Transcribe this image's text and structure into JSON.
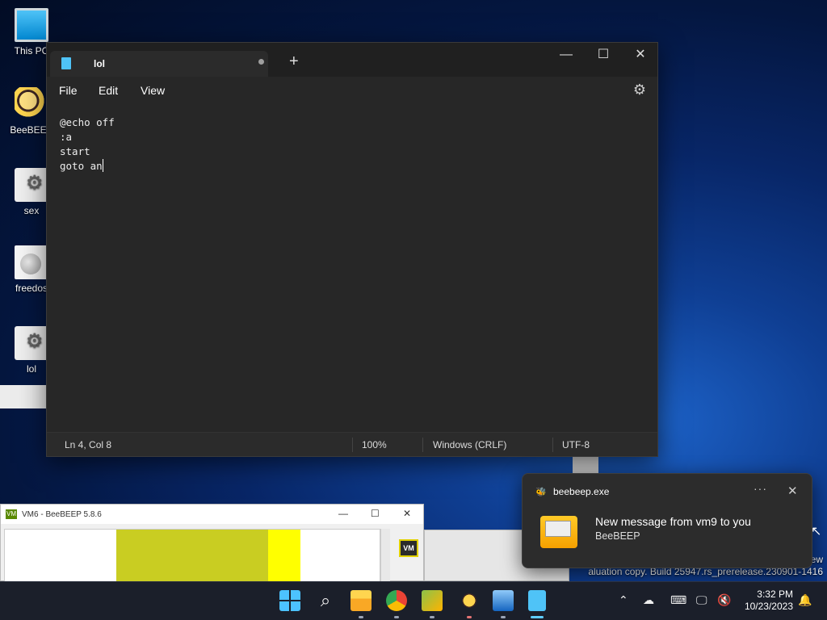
{
  "desktop": {
    "icons": [
      {
        "label": "This PC"
      },
      {
        "label": "BeeBEEP"
      },
      {
        "label": "sex"
      },
      {
        "label": "freedos"
      },
      {
        "label": "lol"
      }
    ]
  },
  "notepad": {
    "tab_title": "lol",
    "menu": [
      "File",
      "Edit",
      "View"
    ],
    "content_lines": [
      "@echo off",
      ":a",
      "start",
      "goto an"
    ],
    "status": {
      "position": "Ln 4, Col 8",
      "zoom": "100%",
      "line_ending": "Windows (CRLF)",
      "encoding": "UTF-8"
    }
  },
  "beebeep_window": {
    "title": "VM6 - BeeBEEP 5.8.6",
    "badge": "VM"
  },
  "notification": {
    "app": "beebeep.exe",
    "message": "New message from vm9 to you",
    "sender": "BeeBEEP"
  },
  "watermark": {
    "line1": "ew",
    "line2": "aluation copy. Build 25947.rs_prerelease.230901-1416"
  },
  "taskbar": {
    "time": "3:32 PM",
    "date": "10/23/2023"
  },
  "colors": {
    "accent": "#60cdff",
    "editor_bg": "#272727",
    "titlebar_bg": "#202020"
  }
}
